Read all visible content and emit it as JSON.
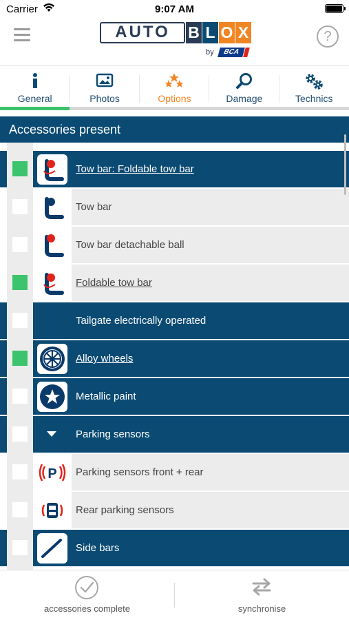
{
  "status_bar": {
    "carrier": "Carrier",
    "time": "9:07 AM"
  },
  "header": {
    "logo_auto": "AUTO",
    "logo_blox": [
      "B",
      "L",
      "O",
      "X"
    ],
    "logo_blox_colors": [
      "#2a3b56",
      "#0a4a73",
      "#f08623",
      "#f08623"
    ],
    "logo_by": "by",
    "logo_bca": "BCA",
    "help": "?"
  },
  "tabs": [
    {
      "label": "General",
      "icon": "info-icon",
      "state": "complete"
    },
    {
      "label": "Photos",
      "icon": "photo-icon",
      "state": "normal"
    },
    {
      "label": "Options",
      "icon": "stars-icon",
      "state": "selected"
    },
    {
      "label": "Damage",
      "icon": "magnifier-icon",
      "state": "normal"
    },
    {
      "label": "Technics",
      "icon": "gears-icon",
      "state": "normal"
    }
  ],
  "section": {
    "title": "Accessories present"
  },
  "rows": [
    {
      "label": "Tow bar: Foldable tow bar",
      "checked": true,
      "style": "dark",
      "link": true,
      "icon": "tow-bar-foldable-icon"
    },
    {
      "label": "Tow bar",
      "checked": false,
      "style": "light",
      "link": false,
      "icon": "tow-bar-icon"
    },
    {
      "label": "Tow bar detachable ball",
      "checked": false,
      "style": "light",
      "link": false,
      "icon": "tow-bar-detachable-icon"
    },
    {
      "label": "Foldable tow bar",
      "checked": true,
      "style": "light",
      "link": true,
      "icon": "tow-bar-foldable-icon"
    },
    {
      "label": "Tailgate electrically operated",
      "checked": false,
      "style": "dark",
      "link": false,
      "icon": "none"
    },
    {
      "label": "Alloy wheels",
      "checked": true,
      "style": "dark",
      "link": true,
      "icon": "alloy-wheel-icon"
    },
    {
      "label": "Metallic paint",
      "checked": false,
      "style": "dark",
      "link": false,
      "icon": "metallic-paint-icon"
    },
    {
      "label": "Parking sensors",
      "checked": false,
      "style": "dark",
      "link": false,
      "icon": "caret-down-icon"
    },
    {
      "label": "Parking sensors front + rear",
      "checked": false,
      "style": "light",
      "link": false,
      "icon": "parking-sensor-front-rear-icon"
    },
    {
      "label": "Rear parking sensors",
      "checked": false,
      "style": "light",
      "link": false,
      "icon": "rear-parking-sensor-icon"
    },
    {
      "label": "Side bars",
      "checked": false,
      "style": "dark",
      "link": false,
      "icon": "side-bars-icon"
    }
  ],
  "bottom": {
    "complete_label": "accessories complete",
    "sync_label": "synchronise"
  },
  "colors": {
    "navy": "#0a4a73",
    "green": "#3cc36b",
    "orange": "#f08623",
    "light_row": "#ececec",
    "red": "#e2231a"
  }
}
